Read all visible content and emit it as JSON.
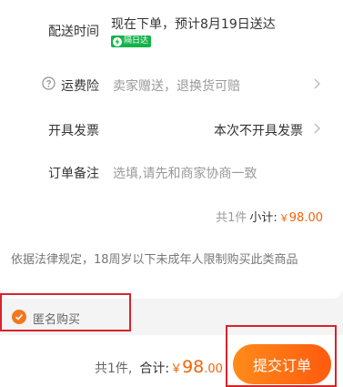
{
  "delivery": {
    "label": "配送时间",
    "value": "现在下单，预计8月19日送达",
    "badge": "隔日达",
    "badge_color": "#14b34a"
  },
  "shipping_insurance": {
    "label": "运费险",
    "value": "卖家赠送，退换货可赔"
  },
  "invoice": {
    "label": "开具发票",
    "value": "本次不开具发票"
  },
  "order_note": {
    "label": "订单备注",
    "placeholder": "选填,请先和商家协商一致"
  },
  "subtotal": {
    "count": "共1件",
    "label": "小计:",
    "currency": "￥",
    "amount": "98.00"
  },
  "legal_notice": "依据法律规定，18周岁以下未成年人限制购买此类商品",
  "anonymous": {
    "label": "匿名购买",
    "checked": true
  },
  "footer": {
    "count": "共1件,",
    "total_label": "合计:",
    "currency": "￥",
    "amount_int": "98",
    "amount_dec": ".00",
    "submit_label": "提交订单"
  },
  "colors": {
    "accent": "#f2640a",
    "highlight_border": "#d8232a"
  }
}
